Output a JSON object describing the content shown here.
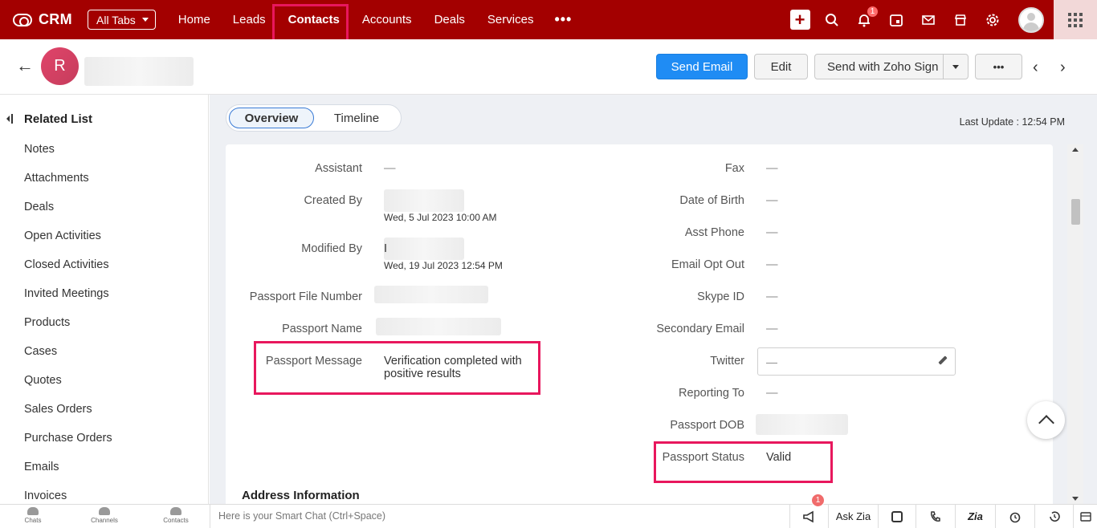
{
  "topbar": {
    "logo": "CRM",
    "all_tabs": "All Tabs",
    "nav": [
      "Home",
      "Leads",
      "Contacts",
      "Accounts",
      "Deals",
      "Services"
    ],
    "more": "•••",
    "notification_count": "1"
  },
  "record": {
    "avatar_initial": "R",
    "buttons": {
      "send_email": "Send Email",
      "edit": "Edit",
      "send_zoho_sign": "Send with Zoho Sign",
      "more": "•••"
    }
  },
  "sidebar": {
    "title": "Related List",
    "items": [
      "Notes",
      "Attachments",
      "Deals",
      "Open Activities",
      "Closed Activities",
      "Invited Meetings",
      "Products",
      "Cases",
      "Quotes",
      "Sales Orders",
      "Purchase Orders",
      "Emails",
      "Invoices"
    ]
  },
  "tabs": {
    "overview": "Overview",
    "timeline": "Timeline"
  },
  "last_update": "Last Update : 12:54 PM",
  "fields_left": {
    "assistant": {
      "label": "Assistant",
      "value": "—"
    },
    "created_by": {
      "label": "Created By",
      "date": "Wed, 5 Jul 2023 10:00 AM"
    },
    "modified_by": {
      "label": "Modified By",
      "value": "I",
      "date": "Wed, 19 Jul 2023 12:54 PM"
    },
    "passport_file_number": {
      "label": "Passport File Number"
    },
    "passport_name": {
      "label": "Passport Name"
    },
    "passport_message": {
      "label": "Passport Message",
      "value": "Verification completed with positive results"
    }
  },
  "fields_right": {
    "fax": {
      "label": "Fax",
      "value": "—"
    },
    "dob": {
      "label": "Date of Birth",
      "value": "—"
    },
    "asst_phone": {
      "label": "Asst Phone",
      "value": "—"
    },
    "email_opt_out": {
      "label": "Email Opt Out",
      "value": "—"
    },
    "skype_id": {
      "label": "Skype ID",
      "value": "—"
    },
    "secondary_email": {
      "label": "Secondary Email",
      "value": "—"
    },
    "twitter": {
      "label": "Twitter",
      "value": "—"
    },
    "reporting_to": {
      "label": "Reporting To",
      "value": "—"
    },
    "passport_dob": {
      "label": "Passport DOB"
    },
    "passport_status": {
      "label": "Passport Status",
      "value": "Valid"
    }
  },
  "section_address": "Address Information",
  "bottombar": {
    "chats": "Chats",
    "channels": "Channels",
    "contacts": "Contacts",
    "smartchat_placeholder": "Here is your Smart Chat (Ctrl+Space)",
    "ask_zia": "Ask Zia",
    "announce_count": "1"
  },
  "colors": {
    "brand": "#a30000",
    "primary_button": "#1f8cf4",
    "highlight": "#e8175d"
  }
}
